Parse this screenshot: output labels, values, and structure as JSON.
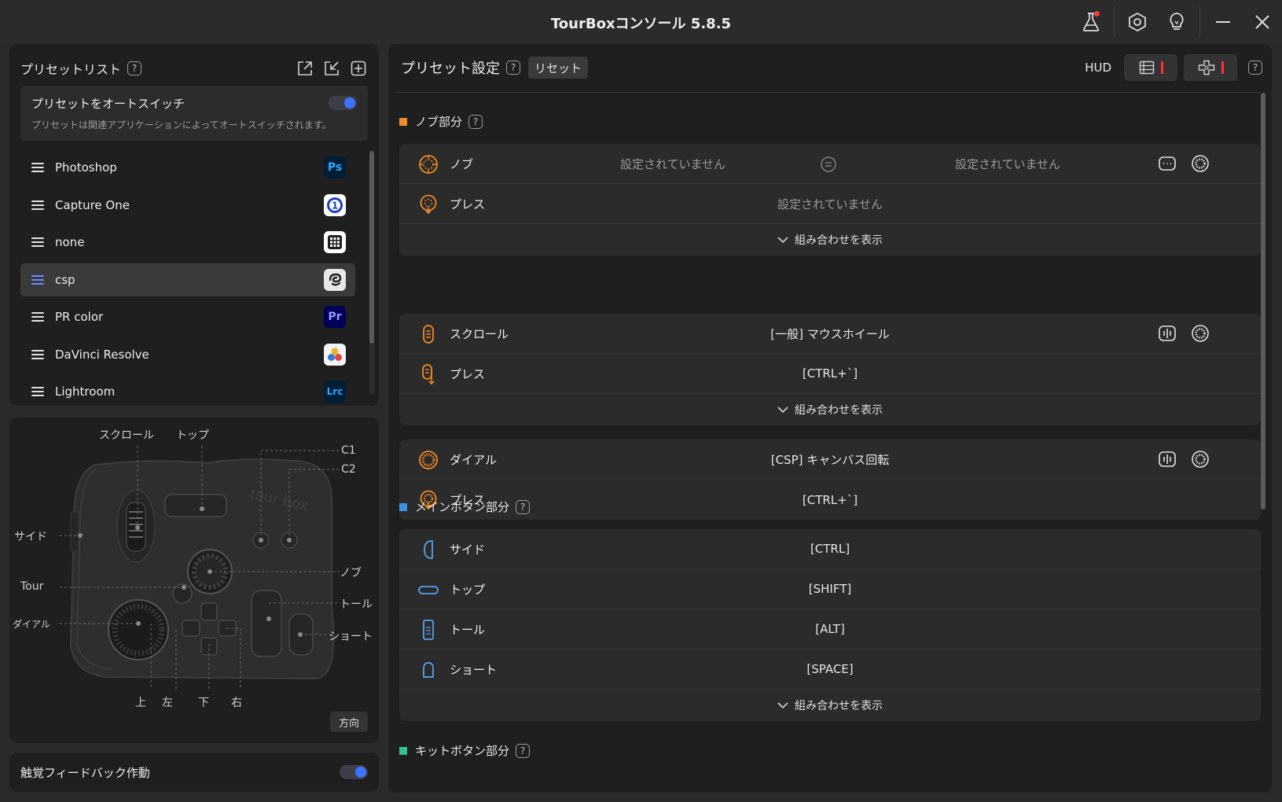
{
  "window": {
    "title": "TourBoxコンソール 5.8.5",
    "icons": [
      "lab-flask-icon",
      "settings-hex-icon",
      "lightbulb-icon",
      "minimize-icon",
      "close-icon"
    ]
  },
  "preset_list": {
    "title": "プリセットリスト",
    "help": "?",
    "actions": [
      "export-icon",
      "import-icon",
      "add-icon"
    ],
    "auto_switch": {
      "title": "プリセットをオートスイッチ",
      "description": "プリセットは関連アプリケーションによってオートスイッチされます。",
      "enabled": true
    },
    "items": [
      {
        "name": "Photoshop",
        "badge": "Ps",
        "badge_bg": "#001e36",
        "badge_fg": "#31a8ff"
      },
      {
        "name": "Capture One",
        "badge": "1",
        "badge_bg": "#ffffff",
        "badge_fg": "#1e3fb8"
      },
      {
        "name": "none",
        "badge": "grid",
        "badge_bg": "#ffffff",
        "badge_fg": "#1f1f1f"
      },
      {
        "name": "csp",
        "badge": "csp",
        "badge_bg": "#e8e8e8",
        "badge_fg": "#1f1f1f",
        "active": true
      },
      {
        "name": "PR color",
        "badge": "Pr",
        "badge_bg": "#00005b",
        "badge_fg": "#9999ff"
      },
      {
        "name": "DaVinci Resolve",
        "badge": "dv",
        "badge_bg": "#ffffff",
        "badge_fg": "#333"
      },
      {
        "name": "Lightroom",
        "badge": "Lrc",
        "badge_bg": "#001e36",
        "badge_fg": "#31a8ff"
      }
    ]
  },
  "device": {
    "labels": {
      "scroll": "スクロール",
      "top": "トップ",
      "c1": "C1",
      "c2": "C2",
      "side": "サイド",
      "knob": "ノブ",
      "tour": "Tour",
      "tall": "トール",
      "dial": "ダイアル",
      "short": "ショート",
      "up": "上",
      "left": "左",
      "down": "下",
      "right": "右"
    },
    "direction_button": "方向",
    "logo_text": "tour box"
  },
  "haptic": {
    "label": "触覚フィードバック作動",
    "enabled": true
  },
  "settings": {
    "title": "プリセット設定",
    "help": "?",
    "reset": "リセット",
    "hud": "HUD",
    "sections": {
      "knob": {
        "title": "ノブ部分",
        "color": "#f08a24",
        "rows": {
          "knob": {
            "label": "ノブ",
            "left": "設定されていません",
            "right": "設定されていません"
          },
          "press": {
            "label": "プレス",
            "value": "設定されていません"
          }
        },
        "combo": "組み合わせを表示"
      },
      "scroll": {
        "rows": {
          "scroll": {
            "label": "スクロール",
            "value": "[一般] マウスホイール"
          },
          "press": {
            "label": "プレス",
            "value": "[CTRL+`]"
          }
        },
        "combo": "組み合わせを表示"
      },
      "dial": {
        "rows": {
          "dial": {
            "label": "ダイアル",
            "value": "[CSP] キャンバス回転"
          },
          "press": {
            "label": "プレス",
            "value": "[CTRL+`]"
          }
        }
      },
      "main": {
        "title": "メインボタン部分",
        "color": "#3d8fe0",
        "rows": {
          "side": {
            "label": "サイド",
            "value": "[CTRL]"
          },
          "top": {
            "label": "トップ",
            "value": "[SHIFT]"
          },
          "tall": {
            "label": "トール",
            "value": "[ALT]"
          },
          "short": {
            "label": "ショート",
            "value": "[SPACE]"
          }
        },
        "combo": "組み合わせを表示"
      },
      "kit": {
        "title": "キットボタン部分",
        "color": "#36c48a"
      }
    }
  }
}
